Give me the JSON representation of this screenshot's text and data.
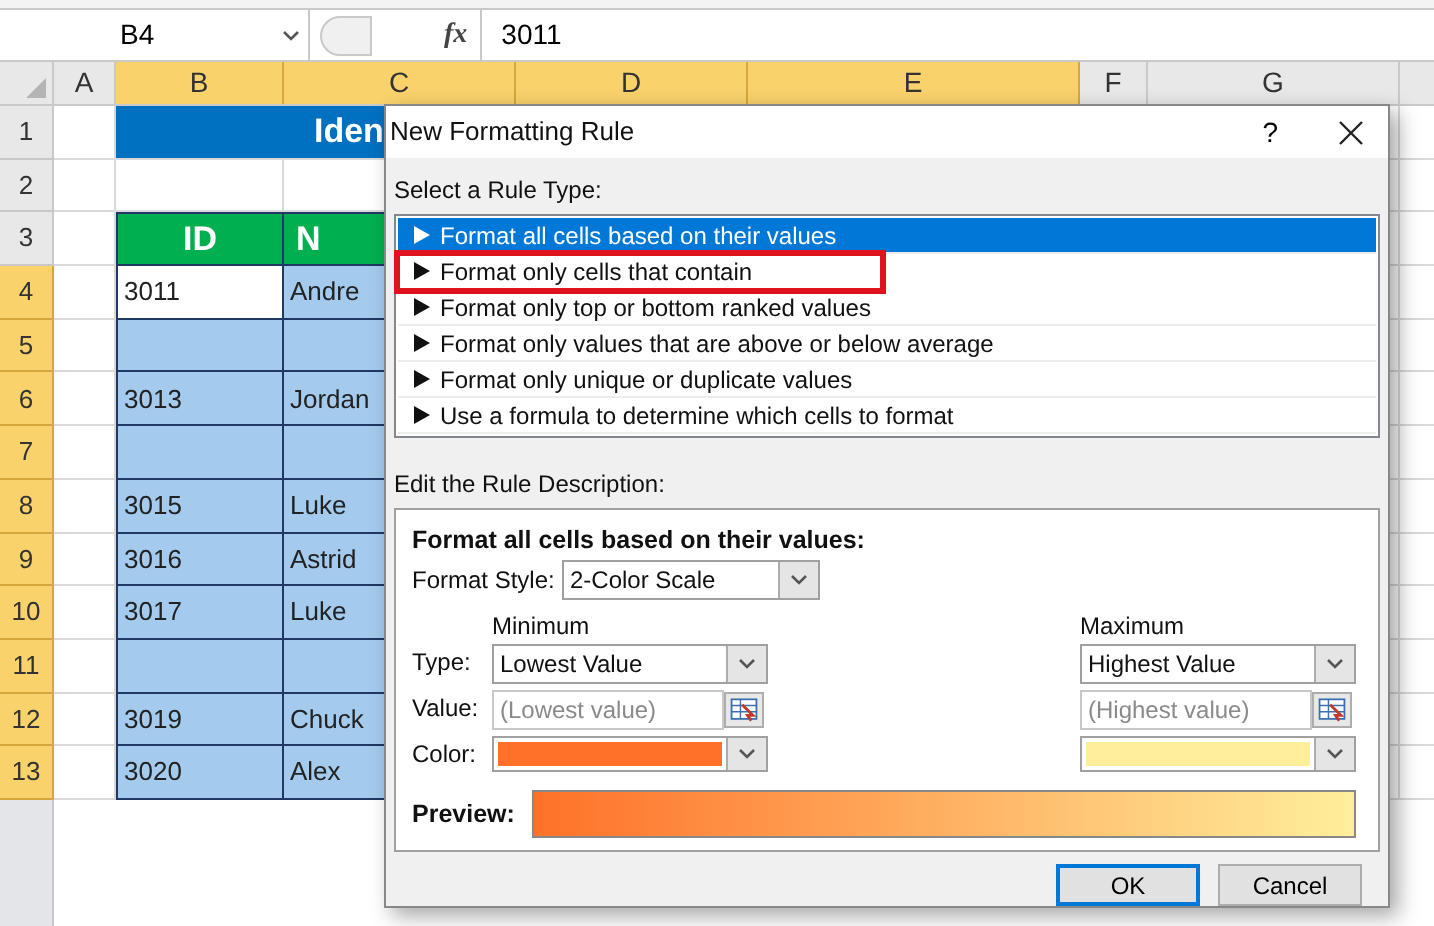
{
  "formula_bar": {
    "name_box": "B4",
    "function_symbol": "fx",
    "value": "3011"
  },
  "sheet": {
    "columns": [
      {
        "label": "A",
        "selected": false
      },
      {
        "label": "B",
        "selected": true
      },
      {
        "label": "C",
        "selected": true
      },
      {
        "label": "D",
        "selected": true
      },
      {
        "label": "E",
        "selected": true
      },
      {
        "label": "F",
        "selected": false
      },
      {
        "label": "G",
        "selected": false
      }
    ],
    "rows": [
      {
        "label": "1",
        "selected": false,
        "kind": "title",
        "text": "Iden"
      },
      {
        "label": "2",
        "selected": false,
        "kind": "empty"
      },
      {
        "label": "3",
        "selected": false,
        "kind": "header",
        "id": "ID",
        "name": "N"
      },
      {
        "label": "4",
        "selected": true,
        "kind": "data",
        "id": "3011",
        "name": "Andre",
        "active": true
      },
      {
        "label": "5",
        "selected": true,
        "kind": "data",
        "active": false
      },
      {
        "label": "6",
        "selected": true,
        "kind": "data",
        "id": "3013",
        "name": "Jordan",
        "active": false
      },
      {
        "label": "7",
        "selected": true,
        "kind": "data",
        "active": false
      },
      {
        "label": "8",
        "selected": true,
        "kind": "data",
        "id": "3015",
        "name": "Luke",
        "active": false
      },
      {
        "label": "9",
        "selected": true,
        "kind": "data",
        "id": "3016",
        "name": "Astrid",
        "active": false
      },
      {
        "label": "10",
        "selected": true,
        "kind": "data",
        "id": "3017",
        "name": "Luke",
        "active": false
      },
      {
        "label": "11",
        "selected": true,
        "kind": "data",
        "active": false
      },
      {
        "label": "12",
        "selected": true,
        "kind": "data",
        "id": "3019",
        "name": "Chuck",
        "active": false
      },
      {
        "label": "13",
        "selected": true,
        "kind": "data",
        "id": "3020",
        "name": "Alex",
        "active": false
      }
    ]
  },
  "dialog": {
    "title": "New Formatting Rule",
    "help": "?",
    "rule_type_label": "Select a Rule Type:",
    "rule_types": [
      {
        "label": "Format all cells based on their values",
        "selected": true,
        "highlighted": false
      },
      {
        "label": "Format only cells that contain",
        "selected": false,
        "highlighted": true
      },
      {
        "label": "Format only top or bottom ranked values",
        "selected": false,
        "highlighted": false
      },
      {
        "label": "Format only values that are above or below average",
        "selected": false,
        "highlighted": false
      },
      {
        "label": "Format only unique or duplicate values",
        "selected": false,
        "highlighted": false
      },
      {
        "label": "Use a formula to determine which cells to format",
        "selected": false,
        "highlighted": false
      }
    ],
    "description_label": "Edit the Rule Description:",
    "description": {
      "heading": "Format all cells based on their values:",
      "format_style_label": "Format Style:",
      "format_style": "2-Color Scale",
      "row_labels": [
        "Type:",
        "Value:",
        "Color:"
      ],
      "minimum": {
        "heading": "Minimum",
        "type": "Lowest Value",
        "placeholder": "(Lowest value)",
        "color": "#ff7128"
      },
      "maximum": {
        "heading": "Maximum",
        "type": "Highest Value",
        "placeholder": "(Highest value)",
        "color": "#ffef9c"
      },
      "preview_label": "Preview:"
    },
    "buttons": [
      {
        "label": "OK",
        "selected": true
      },
      {
        "label": "Cancel",
        "selected": false
      }
    ]
  }
}
